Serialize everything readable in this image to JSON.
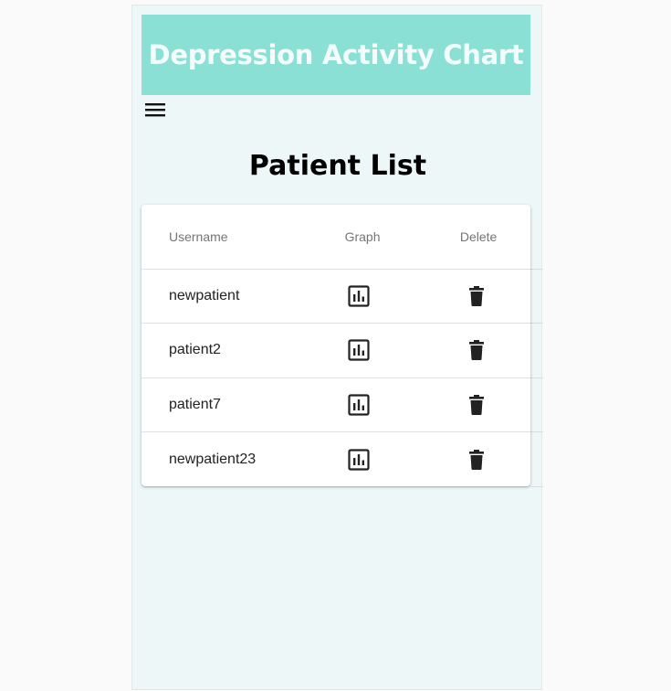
{
  "header": {
    "title": "Depression Activity Chart",
    "background_color": "#8be0d6"
  },
  "menu": {
    "icon": "hamburger-menu-icon"
  },
  "page": {
    "title": "Patient List"
  },
  "table": {
    "columns": [
      "Username",
      "Graph",
      "Delete"
    ],
    "rows": [
      {
        "username": "newpatient",
        "graph_icon": "bar-chart-icon",
        "delete_icon": "trash-icon"
      },
      {
        "username": "patient2",
        "graph_icon": "bar-chart-icon",
        "delete_icon": "trash-icon"
      },
      {
        "username": "patient7",
        "graph_icon": "bar-chart-icon",
        "delete_icon": "trash-icon"
      },
      {
        "username": "newpatient23",
        "graph_icon": "bar-chart-icon",
        "delete_icon": "trash-icon"
      }
    ]
  }
}
